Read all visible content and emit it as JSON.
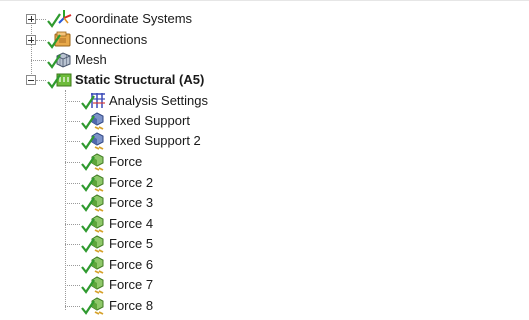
{
  "tree": {
    "items": [
      {
        "label": "Coordinate Systems",
        "icon": "coordinate-systems-icon"
      },
      {
        "label": "Connections",
        "icon": "connections-icon"
      },
      {
        "label": "Mesh",
        "icon": "mesh-icon"
      },
      {
        "label": "Static Structural (A5)",
        "icon": "static-structural-icon"
      },
      {
        "label": "Analysis Settings",
        "icon": "analysis-settings-icon"
      },
      {
        "label": "Fixed Support",
        "icon": "support-icon"
      },
      {
        "label": "Fixed Support 2",
        "icon": "support-icon"
      },
      {
        "label": "Force",
        "icon": "force-icon"
      },
      {
        "label": "Force 2",
        "icon": "force-icon"
      },
      {
        "label": "Force 3",
        "icon": "force-icon"
      },
      {
        "label": "Force 4",
        "icon": "force-icon"
      },
      {
        "label": "Force 5",
        "icon": "force-icon"
      },
      {
        "label": "Force 6",
        "icon": "force-icon"
      },
      {
        "label": "Force 7",
        "icon": "force-icon"
      },
      {
        "label": "Force 8",
        "icon": "force-icon"
      }
    ]
  },
  "colors": {
    "check": "#2f9a2f",
    "tree_line": "#9a9a9a"
  }
}
